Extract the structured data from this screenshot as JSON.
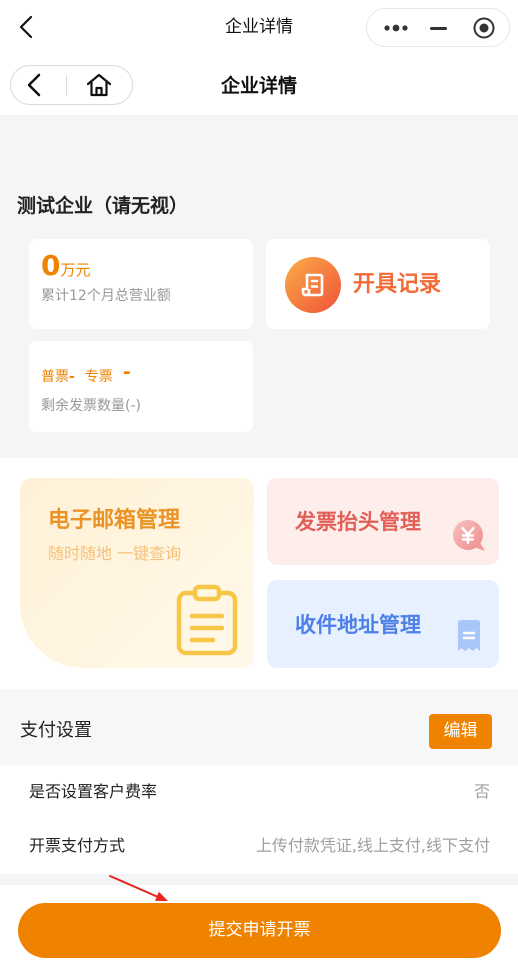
{
  "topbar": {
    "title": "企业详情"
  },
  "header": {
    "title": "企业详情"
  },
  "company": {
    "name": "测试企业（请无视）"
  },
  "stats": {
    "revenue": {
      "value": "0",
      "unit": "万元",
      "label": "累计12个月总营业额"
    },
    "record": {
      "label": "开具记录"
    },
    "invoice_count": {
      "normal_label": "普票",
      "normal_value": "-",
      "special_label": "专票",
      "special_value": "-",
      "label": "剩余发票数量(-)"
    }
  },
  "services": [
    {
      "title": "电子邮箱管理",
      "subtitle": "随时随地 一键查询"
    },
    {
      "title": "发票抬头管理"
    },
    {
      "title": "收件地址管理"
    }
  ],
  "payment": {
    "title": "支付设置",
    "edit_label": "编辑",
    "rows": [
      {
        "label": "是否设置客户费率",
        "value": "否"
      },
      {
        "label": "开票支付方式",
        "value": "上传付款凭证,线上支付,线下支付"
      }
    ]
  },
  "footer": {
    "submit_label": "提交申请开票"
  },
  "icons": {
    "nav_back": "chevron-left-icon",
    "capsule_more": "more-dots-icon",
    "capsule_minimize": "minimize-icon",
    "capsule_close": "target-close-icon",
    "header_back": "chevron-left-icon",
    "header_home": "home-icon",
    "record": "invoice-record-icon",
    "email": "clipboard-icon",
    "title_card": "yuan-bubble-icon",
    "address": "receipt-icon"
  },
  "colors": {
    "accent": "#ef8300",
    "record_text": "#f26a35",
    "email_text": "#eb9425",
    "email_subtext": "#f5c27c",
    "title_card_text": "#e25f57",
    "address_card_text": "#4d80e6",
    "page_bg": "#f4f5f7"
  }
}
